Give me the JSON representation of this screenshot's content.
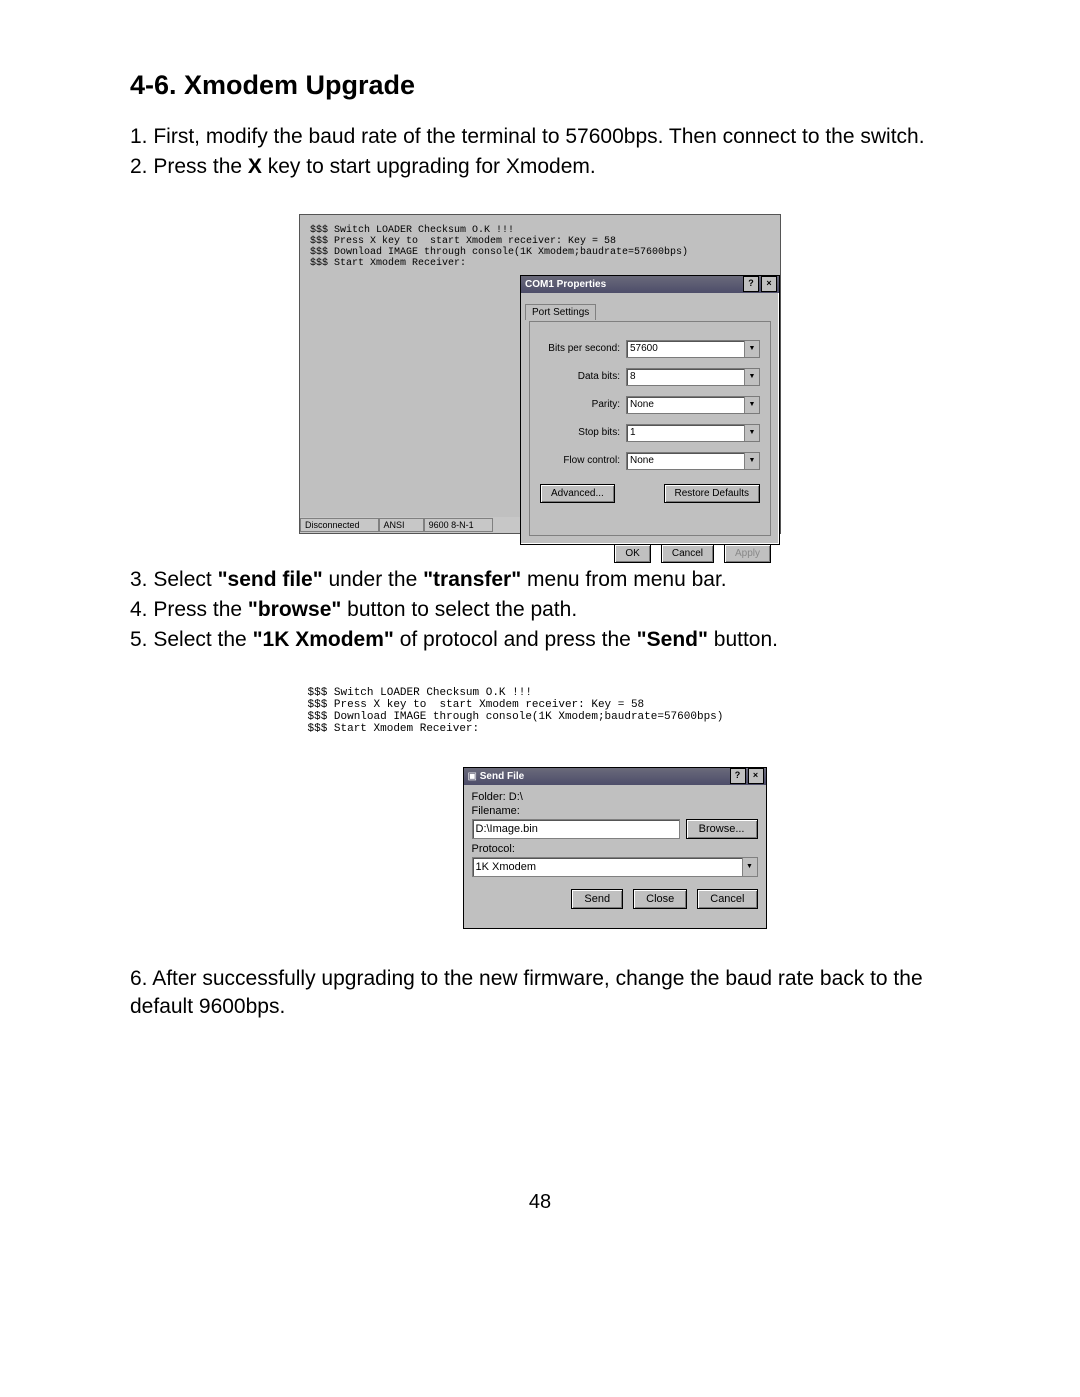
{
  "heading": "4-6. Xmodem Upgrade",
  "steps": {
    "s1": "1. First, modify the baud rate of the terminal to 57600bps.  Then connect to the switch.",
    "s2_a": "2. Press the ",
    "s2_b": "X",
    "s2_c": " key to start upgrading for Xmodem.",
    "s3_a": "3. Select ",
    "s3_b": "\"send file\"",
    "s3_c": " under the ",
    "s3_d": "\"transfer\"",
    "s3_e": " menu from menu bar.",
    "s4_a": "4. Press the ",
    "s4_b": "\"browse\"",
    "s4_c": " button to select the path.",
    "s5_a": "5. Select the ",
    "s5_b": "\"1K Xmodem\"",
    "s5_c": " of protocol and press the ",
    "s5_d": "\"Send\"",
    "s5_e": " button.",
    "s6": "6. After successfully upgrading to the new firmware, change the baud rate back to the default 9600bps."
  },
  "terminal1": "$$$ Switch LOADER Checksum O.K !!!\n$$$ Press X key to  start Xmodem receiver: Key = 58\n$$$ Download IMAGE through console(1K Xmodem;baudrate=57600bps)\n$$$ Start Xmodem Receiver:",
  "status": {
    "disc": "Disconnected",
    "ansi": "ANSI",
    "cfg": "9600 8-N-1"
  },
  "com": {
    "title": "COM1 Properties",
    "tab": "Port Settings",
    "bps_l": "Bits per second:",
    "bps_v": "57600",
    "data_l": "Data bits:",
    "data_v": "8",
    "parity_l": "Parity:",
    "parity_v": "None",
    "stop_l": "Stop bits:",
    "stop_v": "1",
    "flow_l": "Flow control:",
    "flow_v": "None",
    "adv": "Advanced...",
    "rest": "Restore Defaults",
    "ok": "OK",
    "cancel": "Cancel",
    "apply": "Apply"
  },
  "terminal2": "$$$ Switch LOADER Checksum O.K !!!\n$$$ Press X key to  start Xmodem receiver: Key = 58\n$$$ Download IMAGE through console(1K Xmodem;baudrate=57600bps)\n$$$ Start Xmodem Receiver:",
  "sf": {
    "title": "Send File",
    "folder_l": "Folder: ",
    "folder_v": "D:\\",
    "file_l": "Filename:",
    "file_v": "D:\\Image.bin",
    "browse": "Browse...",
    "proto_l": "Protocol:",
    "proto_v": "1K Xmodem",
    "send": "Send",
    "close": "Close",
    "cancel": "Cancel"
  },
  "pageno": "48"
}
